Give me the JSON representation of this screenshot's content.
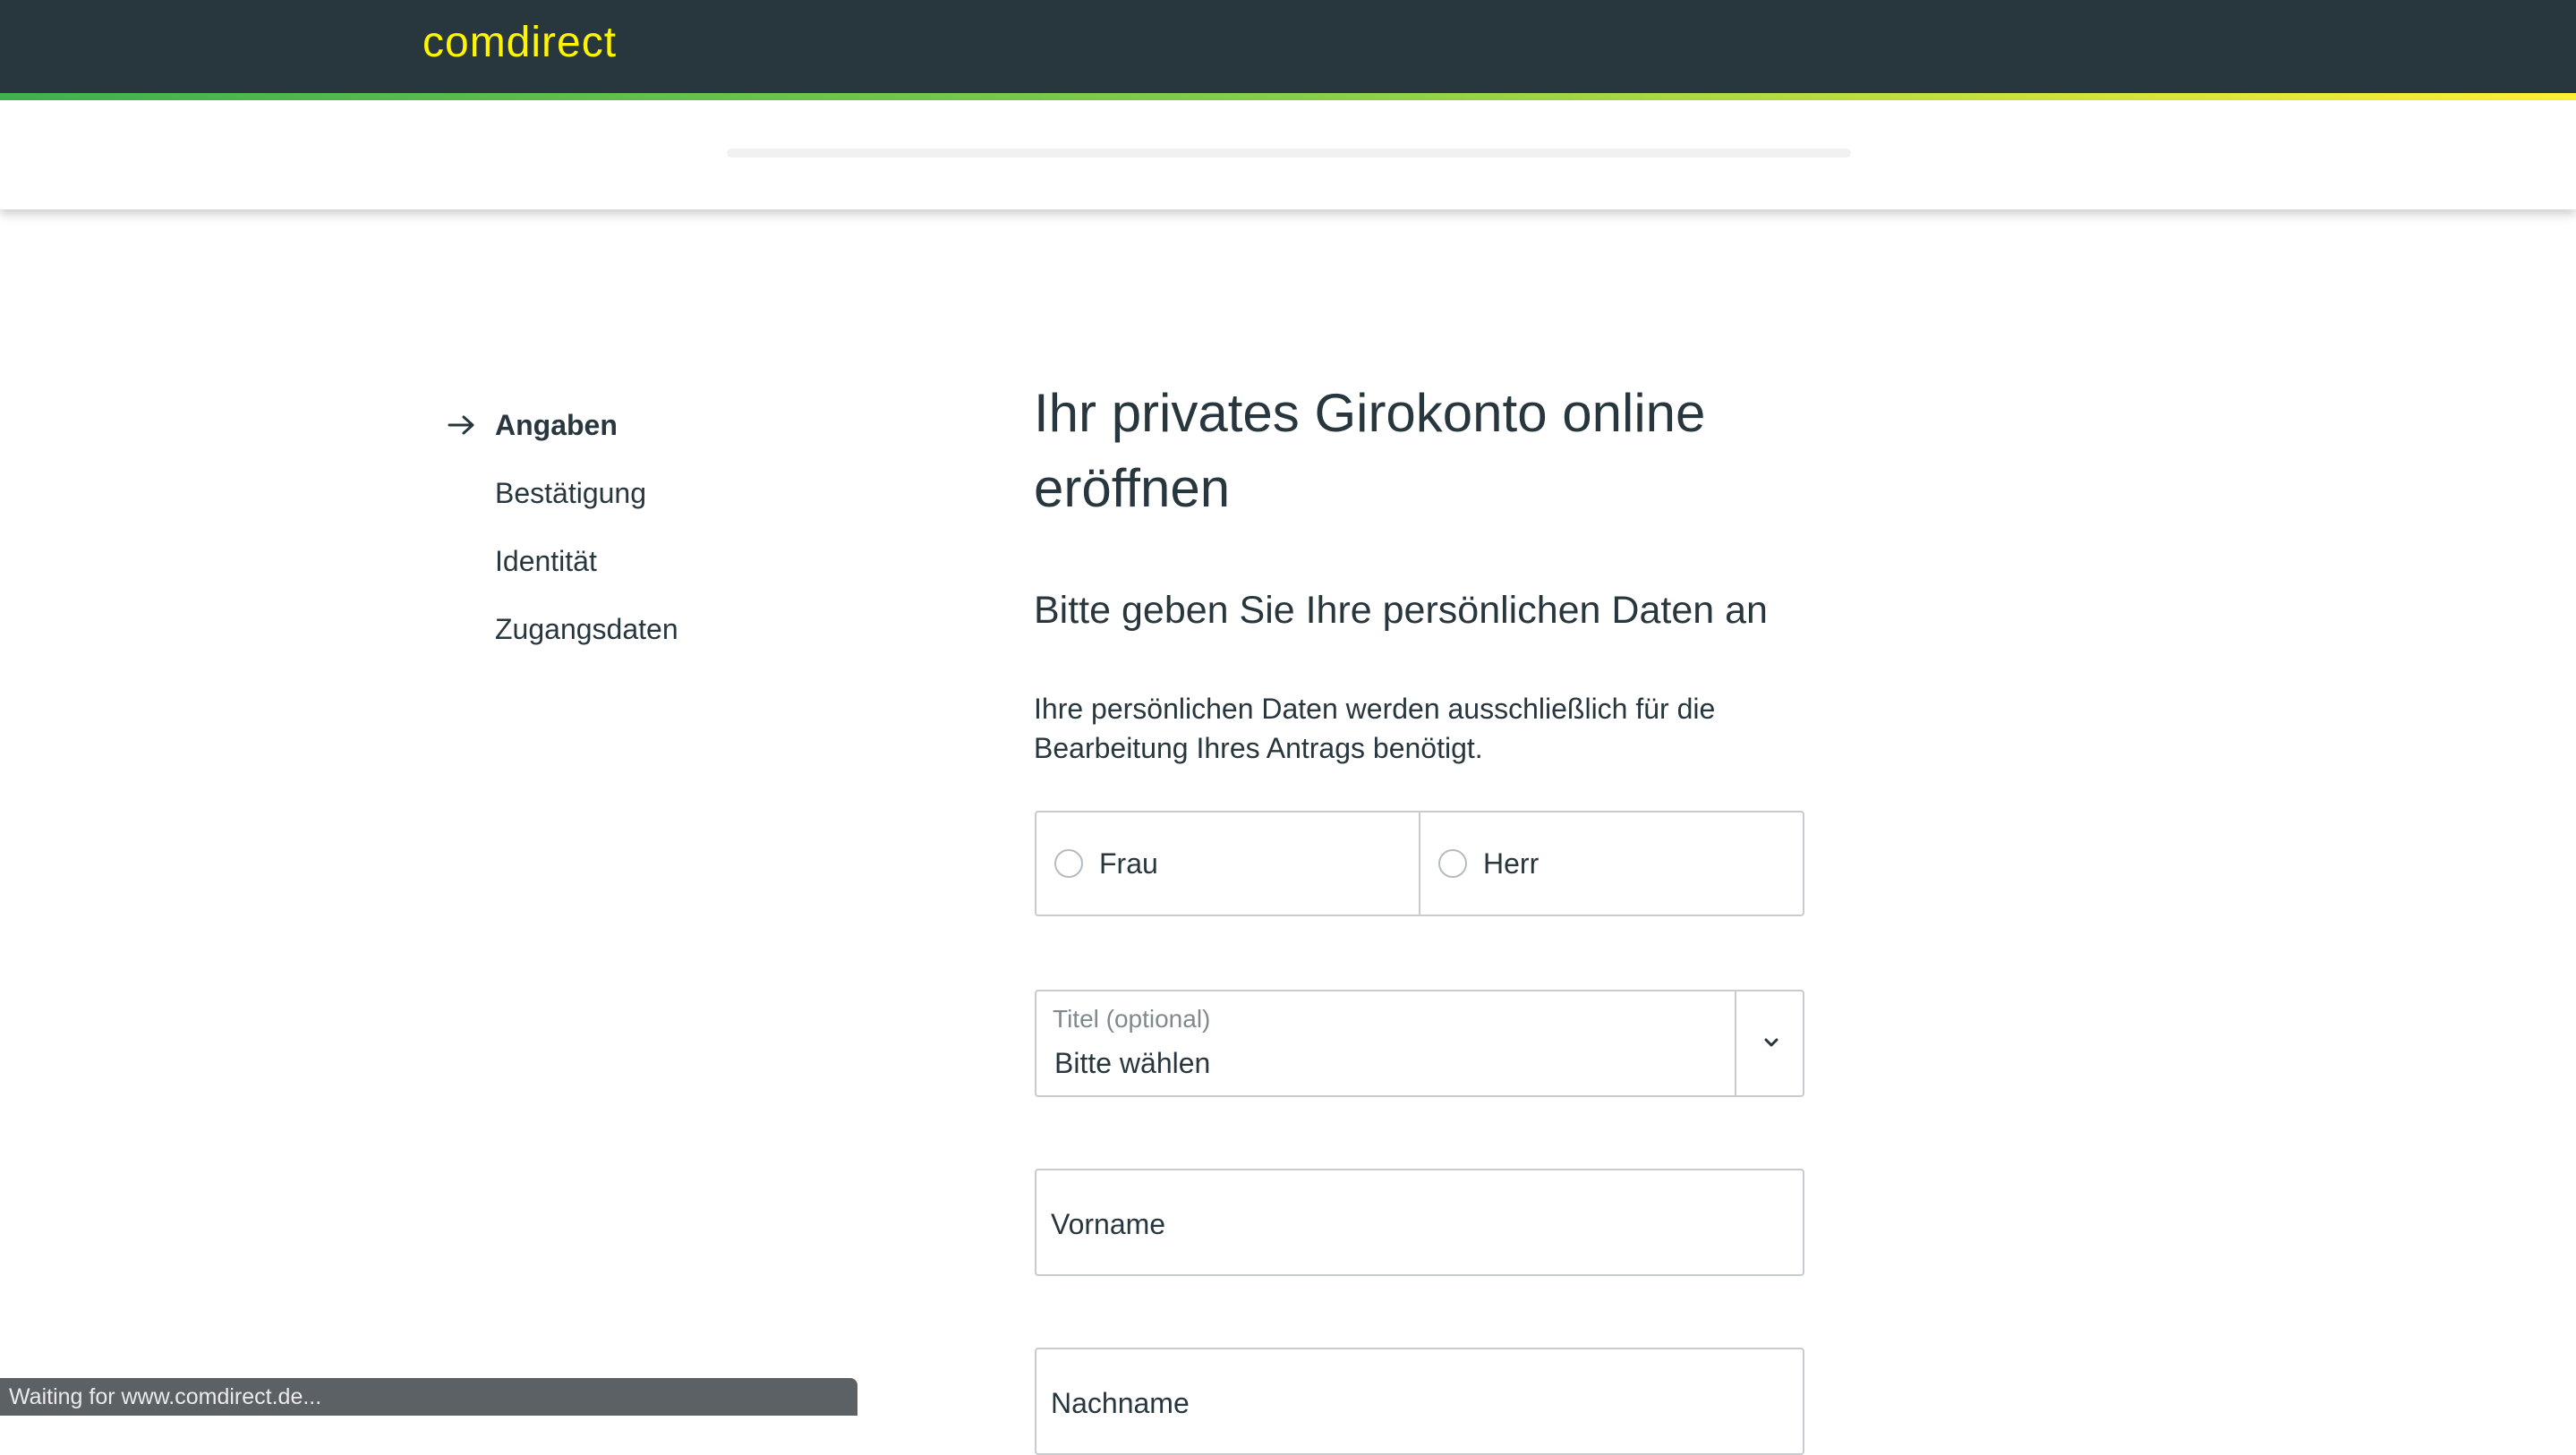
{
  "header": {
    "logo_text": "comdirect",
    "brand_color": "#fff500",
    "bar_color": "#28363e",
    "accent_gradient": [
      "#3fb24e",
      "#fff033"
    ]
  },
  "progress": {
    "value": 0
  },
  "steps": [
    {
      "label": "Angaben",
      "active": true,
      "icon": "arrow-right-icon"
    },
    {
      "label": "Bestätigung",
      "active": false
    },
    {
      "label": "Identität",
      "active": false
    },
    {
      "label": "Zugangsdaten",
      "active": false
    }
  ],
  "main": {
    "title": "Ihr privates Girokonto online eröffnen",
    "section_title": "Bitte geben Sie Ihre persönlichen Daten an",
    "intro": "Ihre persönlichen Daten werden ausschließlich für die Bearbeitung Ihres Antrags benötigt."
  },
  "form": {
    "salutation": {
      "options": [
        "Frau",
        "Herr"
      ],
      "selected": null
    },
    "title_select": {
      "label": "Titel (optional)",
      "value": "Bitte wählen",
      "icon": "chevron-down-icon"
    },
    "first_name": {
      "label": "Vorname",
      "value": ""
    },
    "last_name": {
      "label": "Nachname",
      "value": ""
    }
  },
  "status_bar": {
    "text": "Waiting for www.comdirect.de..."
  }
}
